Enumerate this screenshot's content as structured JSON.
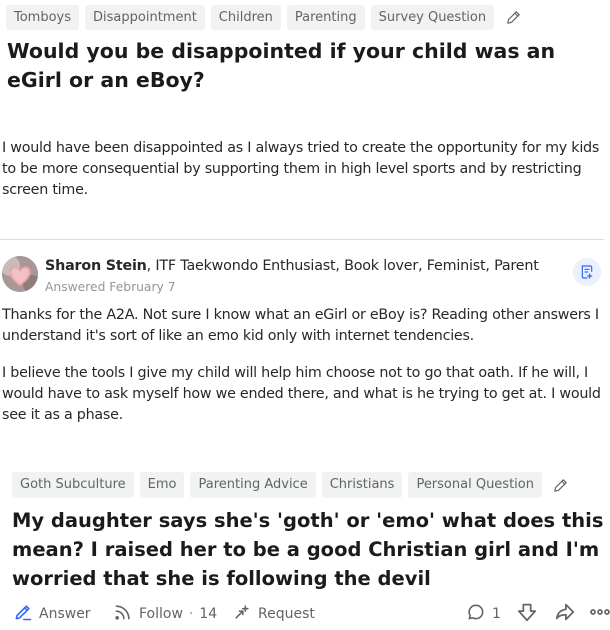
{
  "question1": {
    "tags": [
      "Tomboys",
      "Disappointment",
      "Children",
      "Parenting",
      "Survey Question"
    ],
    "title": "Would you be disappointed if your child was an eGirl or an eBoy?",
    "answer_text": "I would have been disappointed as I always tried to create the opportunity for my kids to be more consequential by supporting them in high level sports and by restricting screen time."
  },
  "answer2": {
    "author_name": "Sharon Stein",
    "author_credentials": ", ITF Taekwondo Enthusiast, Book lover, Feminist, Parent",
    "answered_date": "Answered February 7",
    "paragraph1": "Thanks for the A2A. Not sure I know what an eGirl or eBoy is? Reading other answers I understand it's sort of like an emo kid only with internet tendencies.",
    "paragraph2": "I believe the tools I give my child will help him choose not to go that oath. If he will, I would have to ask myself how we ended there, and what is he trying to get at. I would see it as a phase."
  },
  "question2": {
    "tags": [
      "Goth Subculture",
      "Emo",
      "Parenting Advice",
      "Christians",
      "Personal Question"
    ],
    "title": "My daughter says she's 'goth' or 'emo' what does this mean? I raised her to be a good Christian girl and I'm worried that she is following the devil"
  },
  "actions": {
    "answer_label": "Answer",
    "follow_label": "Follow",
    "follow_separator": "·",
    "follow_count": "14",
    "request_label": "Request",
    "comment_count": "1"
  },
  "icons": [
    "pencil-icon",
    "request-answer-icon",
    "answer-pencil-icon",
    "follow-icon",
    "request-icon",
    "comment-icon",
    "downvote-icon",
    "share-icon",
    "more-icon"
  ],
  "colors": {
    "tag_bg": "#f1f2f2",
    "accent_blue": "#2e69ff",
    "text": "#282829",
    "muted": "#636466"
  }
}
